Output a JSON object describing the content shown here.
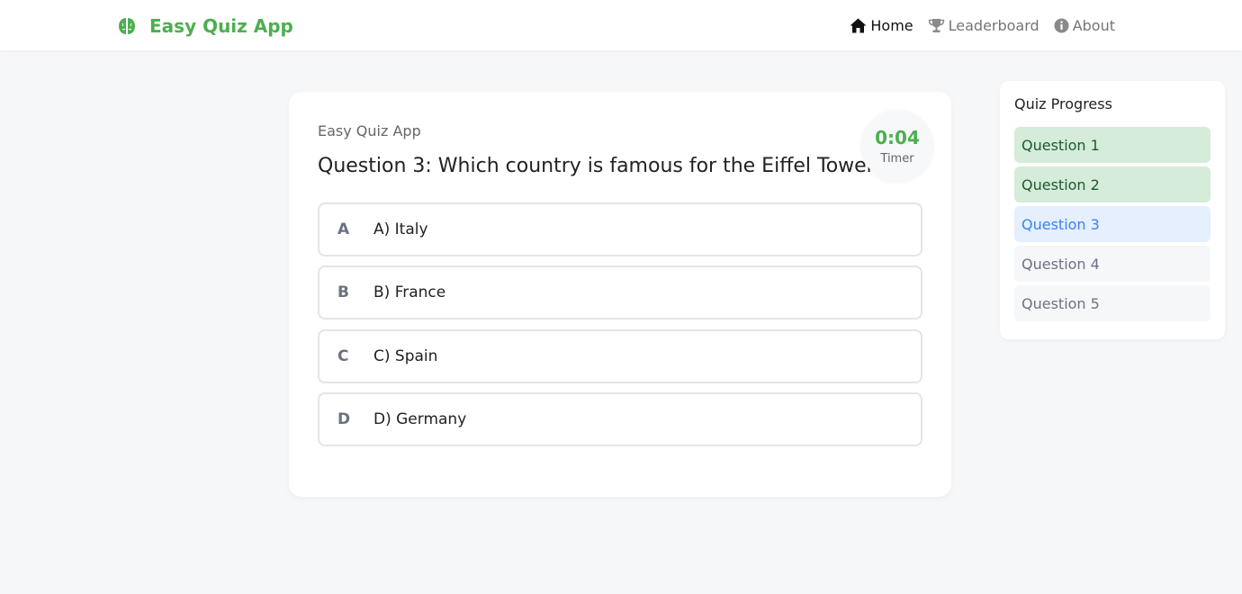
{
  "navbar": {
    "brand": "Easy Quiz App",
    "links": [
      {
        "label": "Home",
        "icon": "home-icon",
        "active": true
      },
      {
        "label": "Leaderboard",
        "icon": "trophy-icon",
        "active": false
      },
      {
        "label": "About",
        "icon": "info-icon",
        "active": false
      }
    ]
  },
  "quiz": {
    "subtitle": "Easy Quiz App",
    "question": "Question 3: Which country is famous for the Eiffel Tower?",
    "timer": {
      "value": "0:04",
      "label": "Timer"
    },
    "options": [
      {
        "letter": "A",
        "text": "A) Italy"
      },
      {
        "letter": "B",
        "text": "B) France"
      },
      {
        "letter": "C",
        "text": "C) Spain"
      },
      {
        "letter": "D",
        "text": "D) Germany"
      }
    ]
  },
  "progress": {
    "title": "Quiz Progress",
    "items": [
      {
        "label": "Question 1",
        "status": "done"
      },
      {
        "label": "Question 2",
        "status": "done"
      },
      {
        "label": "Question 3",
        "status": "current"
      },
      {
        "label": "Question 4",
        "status": "pending"
      },
      {
        "label": "Question 5",
        "status": "pending"
      }
    ]
  },
  "colors": {
    "accent": "#4caf50",
    "current": "#3b82f6",
    "done_bg": "#d4ecd9",
    "current_bg": "#e5effd"
  }
}
